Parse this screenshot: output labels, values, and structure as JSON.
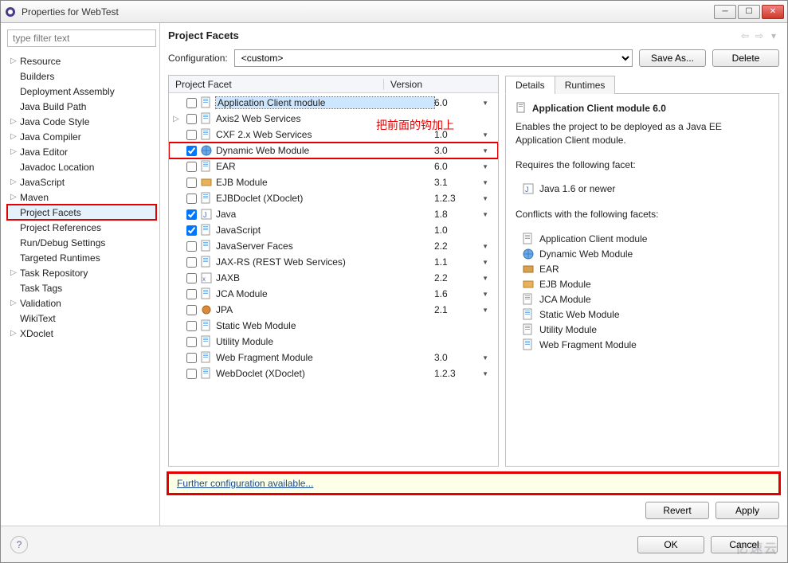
{
  "window": {
    "title": "Properties for WebTest"
  },
  "sidebar": {
    "filter_placeholder": "type filter text",
    "items": [
      {
        "label": "Resource",
        "expand": true
      },
      {
        "label": "Builders",
        "expand": false
      },
      {
        "label": "Deployment Assembly",
        "expand": false
      },
      {
        "label": "Java Build Path",
        "expand": false
      },
      {
        "label": "Java Code Style",
        "expand": true
      },
      {
        "label": "Java Compiler",
        "expand": true
      },
      {
        "label": "Java Editor",
        "expand": true
      },
      {
        "label": "Javadoc Location",
        "expand": false
      },
      {
        "label": "JavaScript",
        "expand": true
      },
      {
        "label": "Maven",
        "expand": true
      },
      {
        "label": "Project Facets",
        "expand": false,
        "selected": true,
        "redbox": true
      },
      {
        "label": "Project References",
        "expand": false
      },
      {
        "label": "Run/Debug Settings",
        "expand": false
      },
      {
        "label": "Targeted Runtimes",
        "expand": false
      },
      {
        "label": "Task Repository",
        "expand": true
      },
      {
        "label": "Task Tags",
        "expand": false
      },
      {
        "label": "Validation",
        "expand": true
      },
      {
        "label": "WikiText",
        "expand": false
      },
      {
        "label": "XDoclet",
        "expand": true
      }
    ]
  },
  "main": {
    "title": "Project Facets",
    "config_label": "Configuration:",
    "config_value": "<custom>",
    "save_as": "Save As...",
    "delete": "Delete",
    "facet_head": {
      "name": "Project Facet",
      "version": "Version"
    },
    "facets": [
      {
        "exp": false,
        "checked": false,
        "icon": "doc",
        "name": "Application Client module",
        "ver": "6.0",
        "dd": true,
        "sel": true
      },
      {
        "exp": true,
        "checked": false,
        "icon": "doc",
        "name": "Axis2 Web Services",
        "ver": "",
        "dd": false
      },
      {
        "exp": false,
        "checked": false,
        "icon": "doc",
        "name": "CXF 2.x Web Services",
        "ver": "1.0",
        "dd": true
      },
      {
        "exp": false,
        "checked": true,
        "icon": "web",
        "name": "Dynamic Web Module",
        "ver": "3.0",
        "dd": true,
        "hl": true
      },
      {
        "exp": false,
        "checked": false,
        "icon": "doc",
        "name": "EAR",
        "ver": "6.0",
        "dd": true
      },
      {
        "exp": false,
        "checked": false,
        "icon": "ejb",
        "name": "EJB Module",
        "ver": "3.1",
        "dd": true
      },
      {
        "exp": false,
        "checked": false,
        "icon": "doc",
        "name": "EJBDoclet (XDoclet)",
        "ver": "1.2.3",
        "dd": true
      },
      {
        "exp": false,
        "checked": true,
        "icon": "java",
        "name": "Java",
        "ver": "1.8",
        "dd": true
      },
      {
        "exp": false,
        "checked": true,
        "icon": "doc",
        "name": "JavaScript",
        "ver": "1.0",
        "dd": false
      },
      {
        "exp": false,
        "checked": false,
        "icon": "doc",
        "name": "JavaServer Faces",
        "ver": "2.2",
        "dd": true
      },
      {
        "exp": false,
        "checked": false,
        "icon": "doc",
        "name": "JAX-RS (REST Web Services)",
        "ver": "1.1",
        "dd": true
      },
      {
        "exp": false,
        "checked": false,
        "icon": "jaxb",
        "name": "JAXB",
        "ver": "2.2",
        "dd": true
      },
      {
        "exp": false,
        "checked": false,
        "icon": "doc",
        "name": "JCA Module",
        "ver": "1.6",
        "dd": true
      },
      {
        "exp": false,
        "checked": false,
        "icon": "jpa",
        "name": "JPA",
        "ver": "2.1",
        "dd": true
      },
      {
        "exp": false,
        "checked": false,
        "icon": "doc",
        "name": "Static Web Module",
        "ver": "",
        "dd": false
      },
      {
        "exp": false,
        "checked": false,
        "icon": "doc",
        "name": "Utility Module",
        "ver": "",
        "dd": false
      },
      {
        "exp": false,
        "checked": false,
        "icon": "doc",
        "name": "Web Fragment Module",
        "ver": "3.0",
        "dd": true
      },
      {
        "exp": false,
        "checked": false,
        "icon": "doc",
        "name": "WebDoclet (XDoclet)",
        "ver": "1.2.3",
        "dd": true
      }
    ],
    "annotation": "把前面的钩加上",
    "tabs": {
      "details": "Details",
      "runtimes": "Runtimes"
    },
    "details": {
      "heading": "Application Client module 6.0",
      "desc": "Enables the project to be deployed as a Java EE Application Client module.",
      "requires_label": "Requires the following facet:",
      "requires": [
        {
          "icon": "java",
          "label": "Java 1.6 or newer"
        }
      ],
      "conflicts_label": "Conflicts with the following facets:",
      "conflicts": [
        {
          "icon": "doc",
          "label": "Application Client module"
        },
        {
          "icon": "web",
          "label": "Dynamic Web Module"
        },
        {
          "icon": "ear",
          "label": "EAR"
        },
        {
          "icon": "ejb",
          "label": "EJB Module"
        },
        {
          "icon": "doc",
          "label": "JCA Module"
        },
        {
          "icon": "doc",
          "label": "Static Web Module"
        },
        {
          "icon": "doc",
          "label": "Utility Module"
        },
        {
          "icon": "doc",
          "label": "Web Fragment Module"
        }
      ]
    },
    "further": "Further configuration available...",
    "revert": "Revert",
    "apply": "Apply"
  },
  "footer": {
    "ok": "OK",
    "cancel": "Cancel"
  },
  "watermark": "亿速云"
}
